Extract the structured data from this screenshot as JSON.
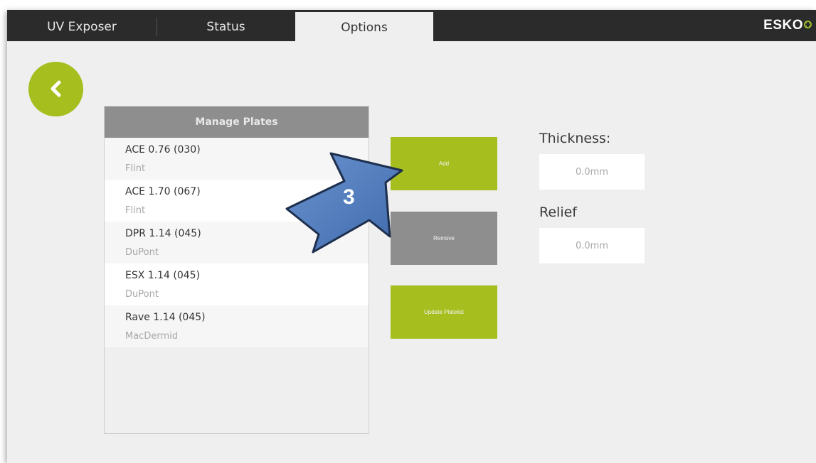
{
  "tabs": [
    {
      "label": "UV Exposer"
    },
    {
      "label": "Status"
    },
    {
      "label": "Options"
    }
  ],
  "active_tab": "Options",
  "brand": {
    "name": "ESKO",
    "accent_color": "#a6be1e"
  },
  "back_button": {
    "icon": "chevron-left-icon"
  },
  "plates": {
    "header": "Manage Plates",
    "items": [
      {
        "name": "ACE 0.76 (030)",
        "maker": "Flint"
      },
      {
        "name": "ACE 1.70 (067)",
        "maker": "Flint"
      },
      {
        "name": "DPR 1.14 (045)",
        "maker": "DuPont"
      },
      {
        "name": "ESX 1.14 (045)",
        "maker": "DuPont"
      },
      {
        "name": "Rave 1.14 (045)",
        "maker": "MacDermid"
      }
    ]
  },
  "actions": {
    "add": "Add",
    "remove": "Remove",
    "update": "Update Platelist"
  },
  "fields": {
    "thickness_label": "Thickness:",
    "thickness_placeholder": "0.0mm",
    "relief_label": "Relief",
    "relief_placeholder": "0.0mm"
  },
  "annotation": {
    "step_number": "3",
    "arrow_color": "#4f7cbe"
  }
}
